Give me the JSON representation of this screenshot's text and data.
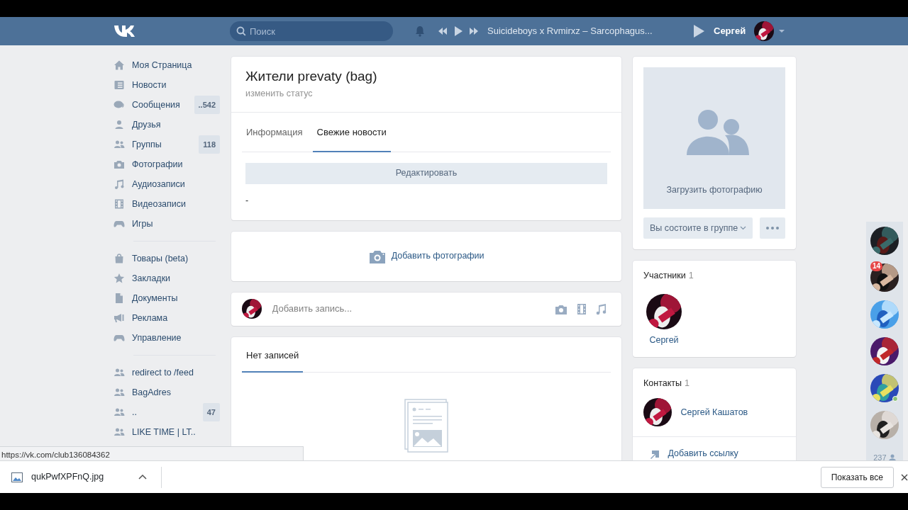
{
  "header": {
    "search": {
      "placeholder": "Поиск"
    },
    "player": {
      "track": "Suicideboys x Rvmirxz – Sarcophagus..."
    },
    "user": {
      "name": "Сергей"
    }
  },
  "sidebar": {
    "groups": [
      [
        {
          "kind": "home",
          "label": "Моя Страница"
        },
        {
          "kind": "news",
          "label": "Новости"
        },
        {
          "kind": "messages",
          "label": "Сообщения",
          "count": "..542"
        },
        {
          "kind": "friends",
          "label": "Друзья"
        },
        {
          "kind": "groups",
          "label": "Группы",
          "count": "118"
        },
        {
          "kind": "photos",
          "label": "Фотографии"
        },
        {
          "kind": "audio",
          "label": "Аудиозаписи"
        },
        {
          "kind": "video",
          "label": "Видеозаписи"
        },
        {
          "kind": "games",
          "label": "Игры"
        }
      ],
      [
        {
          "kind": "market",
          "label": "Товары (beta)"
        },
        {
          "kind": "bookmarks",
          "label": "Закладки"
        },
        {
          "kind": "docs",
          "label": "Документы"
        },
        {
          "kind": "ads",
          "label": "Реклама"
        },
        {
          "kind": "games",
          "label": "Управление"
        }
      ],
      [
        {
          "kind": "groups",
          "label": "redirect to /feed"
        },
        {
          "kind": "groups",
          "label": "BagAdres"
        },
        {
          "kind": "groups",
          "label": "..",
          "count": "47"
        },
        {
          "kind": "groups",
          "label": "LIKE TIME | LT.."
        }
      ]
    ]
  },
  "group": {
    "title": "Жители prevaty (bag)",
    "status": "изменить статус",
    "tabs": [
      {
        "label": "Информация",
        "selected": false
      },
      {
        "label": "Свежие новости",
        "selected": true
      }
    ],
    "edit_button": "Редактировать",
    "content": "-"
  },
  "add_photos": "Добавить фотографии",
  "post_box": {
    "placeholder": "Добавить запись..."
  },
  "wall": {
    "tabs": [
      {
        "label": "Нет записей",
        "selected": true
      }
    ]
  },
  "cover": {
    "upload": "Загрузить фотографию",
    "membership": "Вы состоите в группе"
  },
  "members": {
    "title": "Участники",
    "count": "1",
    "items": [
      {
        "name": "Сергей"
      }
    ]
  },
  "contacts": {
    "title": "Контакты",
    "count": "1",
    "items": [
      {
        "name": "Сергей Кашатов"
      }
    ],
    "add_link": "Добавить ссылку"
  },
  "friends_bar": {
    "items": [
      {
        "online": false
      },
      {
        "online": false,
        "badge": "14"
      },
      {
        "online": false
      },
      {
        "online": false
      },
      {
        "online": true
      },
      {
        "online": false
      }
    ],
    "count": "237"
  },
  "status_url": "https://vk.com/club136084362",
  "downloads": {
    "file": "qukPwfXPFnQ.jpg",
    "show_all": "Показать все"
  }
}
